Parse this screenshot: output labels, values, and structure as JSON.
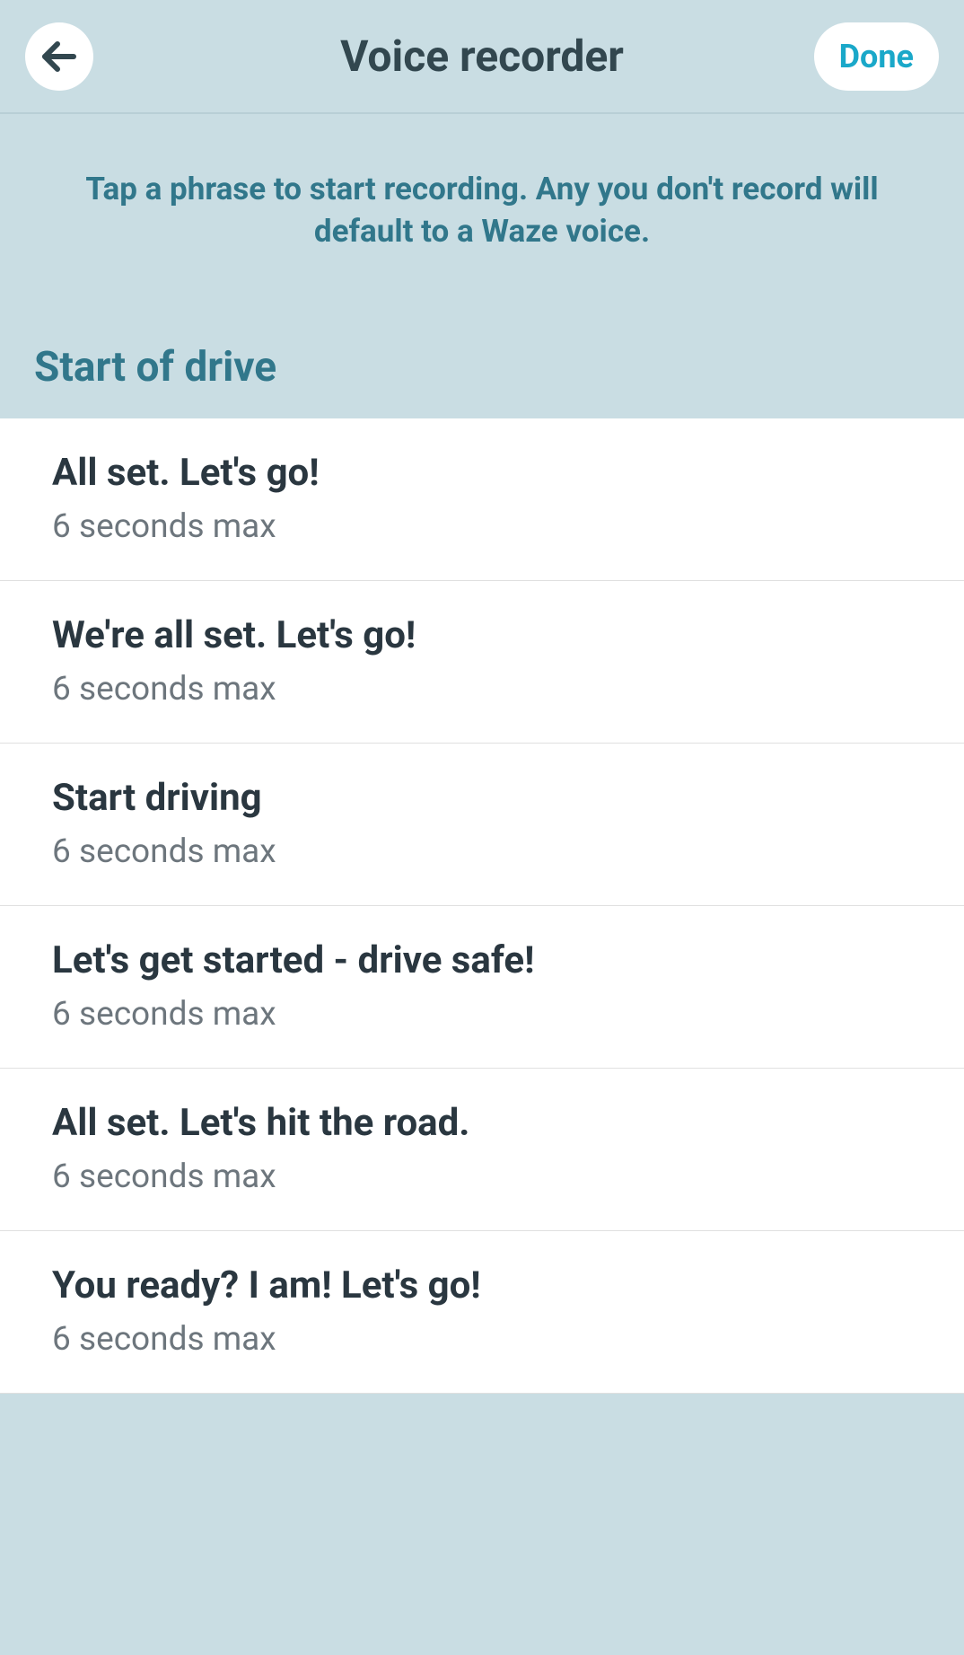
{
  "header": {
    "title": "Voice recorder",
    "done_label": "Done"
  },
  "instruction": "Tap a phrase to start recording. Any you don't record will default to a Waze voice.",
  "section": {
    "title": "Start of drive"
  },
  "phrases": [
    {
      "title": "All set. Let's go!",
      "subtitle": "6 seconds max"
    },
    {
      "title": "We're all set. Let's go!",
      "subtitle": "6 seconds max"
    },
    {
      "title": "Start driving",
      "subtitle": "6 seconds max"
    },
    {
      "title": "Let's get started - drive safe!",
      "subtitle": "6 seconds max"
    },
    {
      "title": "All set. Let's hit the road.",
      "subtitle": "6 seconds max"
    },
    {
      "title": "You ready? I am! Let's go!",
      "subtitle": "6 seconds max"
    }
  ]
}
